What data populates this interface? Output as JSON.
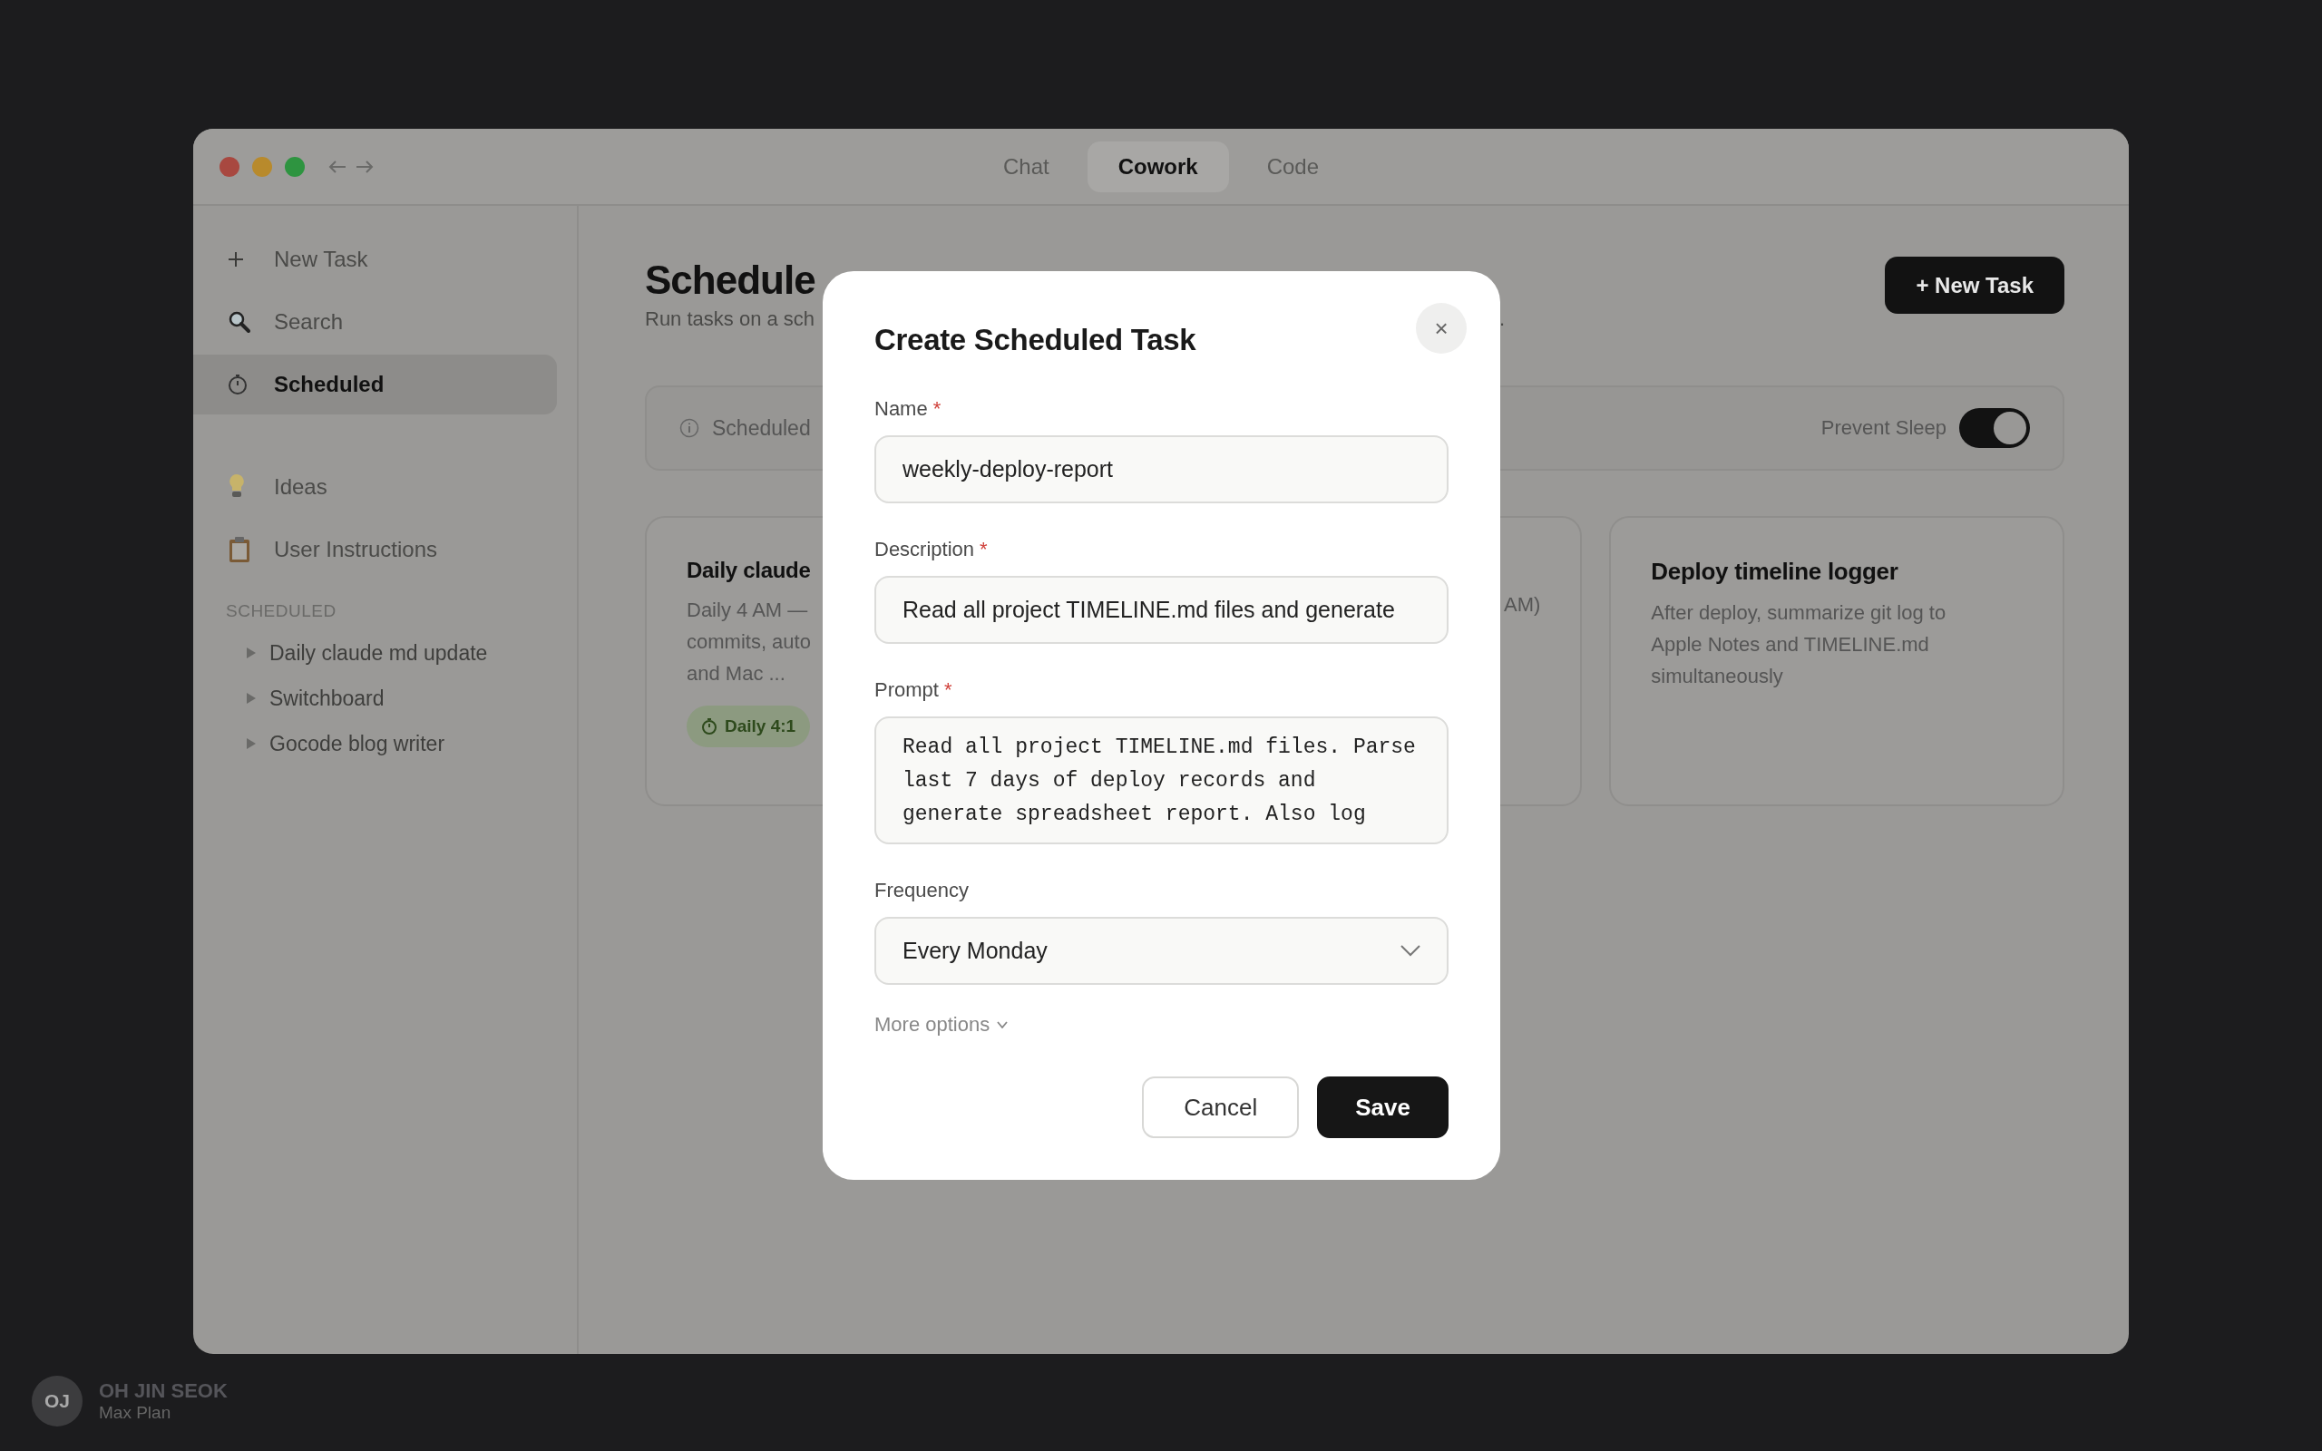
{
  "window": {
    "tabs": [
      {
        "label": "Chat",
        "selected": false
      },
      {
        "label": "Cowork",
        "selected": true
      },
      {
        "label": "Code",
        "selected": false
      }
    ]
  },
  "sidebar": {
    "items": [
      {
        "kind": "plus",
        "label": "New Task",
        "selected": false
      },
      {
        "kind": "search",
        "label": "Search",
        "selected": false
      },
      {
        "kind": "stopwatch",
        "label": "Scheduled",
        "selected": true
      },
      {
        "kind": "bulb",
        "label": "Ideas",
        "selected": false
      },
      {
        "kind": "clipboard",
        "label": "User Instructions",
        "selected": false
      }
    ],
    "section_title": "SCHEDULED",
    "tree": [
      {
        "label": "Daily claude md update",
        "expanded": false
      },
      {
        "label": "Switchboard",
        "expanded": false
      },
      {
        "label": "Gocode blog writer",
        "expanded": false
      }
    ]
  },
  "main": {
    "title": "Schedule",
    "subtitle": "Run tasks on a sch",
    "subtitle_tail": ".",
    "new_task_button": "+ New Task",
    "info_bar": {
      "text": "Scheduled",
      "prevent_sleep": {
        "label": "Prevent Sleep",
        "on": true
      }
    },
    "cards": [
      {
        "title": "Daily claude",
        "lines": [
          "Daily 4 AM —",
          "commits, auto",
          "and Mac ..."
        ],
        "schedule": "Daily 4:1"
      },
      {
        "lines": [
          "AM)"
        ]
      },
      {
        "title": "Deploy timeline logger",
        "lines": [
          "After deploy, summarize git log to Apple Notes and TIMELINE.md simultaneously"
        ]
      }
    ]
  },
  "modal": {
    "title": "Create Scheduled Task",
    "close": "×",
    "fields": [
      {
        "kind": "input",
        "label": "Name",
        "marker": "*",
        "value": "weekly-deploy-report"
      },
      {
        "kind": "input",
        "label": "Description",
        "marker": "*",
        "value": "Read all project TIMELINE.md files and generate"
      },
      {
        "kind": "textarea",
        "label": "Prompt",
        "marker": "*",
        "value": "Read all project TIMELINE.md files. Parse last 7 days of deploy records and generate spreadsheet report. Also log"
      },
      {
        "kind": "select",
        "label": "Frequency",
        "value": "Every Monday"
      }
    ],
    "more_options": "More options",
    "buttons": [
      {
        "kind": "secondary",
        "label": "Cancel"
      },
      {
        "kind": "primary",
        "label": "Save"
      }
    ]
  },
  "user": {
    "initials": "OJ",
    "name": "OH JIN SEOK",
    "plan": "Max Plan"
  }
}
